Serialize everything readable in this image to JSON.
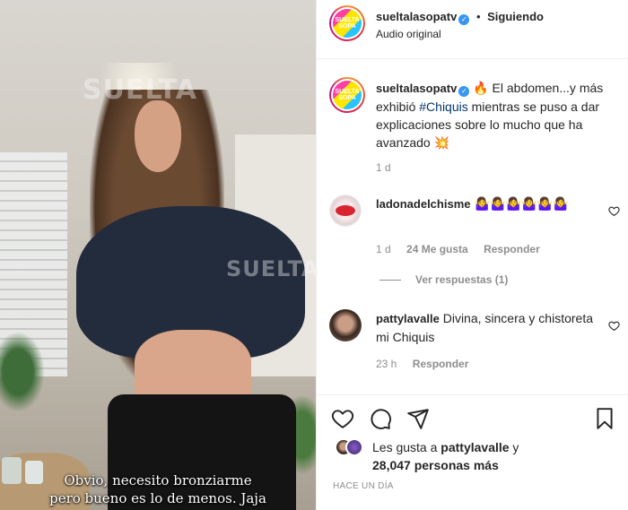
{
  "video": {
    "watermark_top": "SUELTA",
    "watermark_mid": "SUELTA",
    "caption_line1": "Obvio, necesito bronziarme",
    "caption_line2": "pero bueno es lo de menos. Jaja"
  },
  "header": {
    "username": "sueltalasopatv",
    "separator": "•",
    "follow_status": "Siguiendo",
    "audio": "Audio original",
    "avatar_text": "SUELTA LA SOPA"
  },
  "post": {
    "username": "sueltalasopatv",
    "fire_emoji": "🔥",
    "text_before": " El abdomen...y más exhibió ",
    "hashtag": "#Chiquis",
    "text_after": " mientras se puso a dar explicaciones sobre lo mucho que ha avanzado ",
    "end_emoji": "💥",
    "time": "1 d"
  },
  "comments": [
    {
      "username": "ladonadelchisme",
      "text": " 🤷‍♀️🤷‍♀️🤷‍♀️🤷‍♀️🤷‍♀️🤷‍♀️",
      "time": "1 d",
      "likes": "24 Me gusta",
      "reply": "Responder",
      "view_replies": "Ver respuestas (1)"
    },
    {
      "username": "pattylavalle",
      "text": " Divina, sincera y chistoreta mi Chiquis",
      "time": "23 h",
      "reply": "Responder"
    }
  ],
  "likes": {
    "prefix": "Les gusta a ",
    "user": "pattylavalle",
    "connector": " y",
    "others": "28,047 personas más"
  },
  "timestamp": "HACE UN DÍA",
  "icons": [
    "heart-icon",
    "comment-icon",
    "share-icon",
    "bookmark-icon",
    "verified-icon"
  ],
  "colors": {
    "link": "#00376b",
    "secondary_text": "#8e8e8e",
    "verified": "#3897f0"
  }
}
